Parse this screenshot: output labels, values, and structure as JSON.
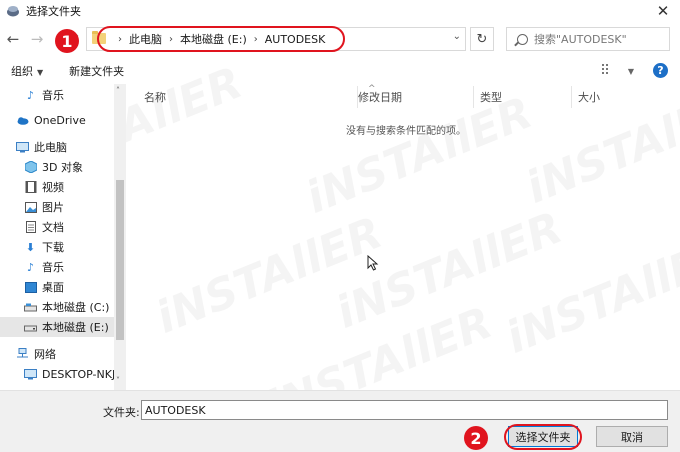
{
  "window": {
    "title": "选择文件夹",
    "close_glyph": "✕"
  },
  "nav": {
    "back_glyph": "←",
    "forward_glyph": "→",
    "breadcrumbs": [
      "此电脑",
      "本地磁盘 (E:)",
      "AUTODESK"
    ],
    "crumb_separator": "›",
    "refresh_glyph": "↻",
    "search_placeholder": "搜索\"AUTODESK\""
  },
  "toolbar": {
    "organize_label": "组织",
    "new_folder_label": "新建文件夹",
    "help_glyph": "?"
  },
  "sidebar": {
    "items": [
      {
        "label": "音乐",
        "icon": "music-icon"
      },
      {
        "label": "OneDrive",
        "icon": "cloud-icon"
      },
      {
        "label": "此电脑",
        "icon": "computer-icon"
      },
      {
        "label": "3D 对象",
        "icon": "cube-icon"
      },
      {
        "label": "视频",
        "icon": "video-icon"
      },
      {
        "label": "图片",
        "icon": "picture-icon"
      },
      {
        "label": "文档",
        "icon": "document-icon"
      },
      {
        "label": "下载",
        "icon": "download-icon"
      },
      {
        "label": "音乐",
        "icon": "music-icon"
      },
      {
        "label": "桌面",
        "icon": "desktop-icon"
      },
      {
        "label": "本地磁盘 (C:)",
        "icon": "drive-icon"
      },
      {
        "label": "本地磁盘 (E:)",
        "icon": "drive-icon",
        "selected": true
      },
      {
        "label": "网络",
        "icon": "network-icon"
      },
      {
        "label": "DESKTOP-NKJI",
        "icon": "computer-icon"
      }
    ]
  },
  "filelist": {
    "columns": [
      "名称",
      "修改日期",
      "类型",
      "大小"
    ],
    "empty_message": "没有与搜索条件匹配的项。"
  },
  "footer": {
    "filename_label": "文件夹:",
    "filename_value": "AUTODESK",
    "select_button": "选择文件夹",
    "cancel_button": "取消"
  },
  "annotations": {
    "badge_1": "1",
    "badge_2": "2",
    "highlight_color": "#e0141e"
  },
  "watermark": "iNSTAllER",
  "colors": {
    "accent": "#0078d7",
    "help": "#1d6fc7",
    "folder": "#f3d27a"
  }
}
